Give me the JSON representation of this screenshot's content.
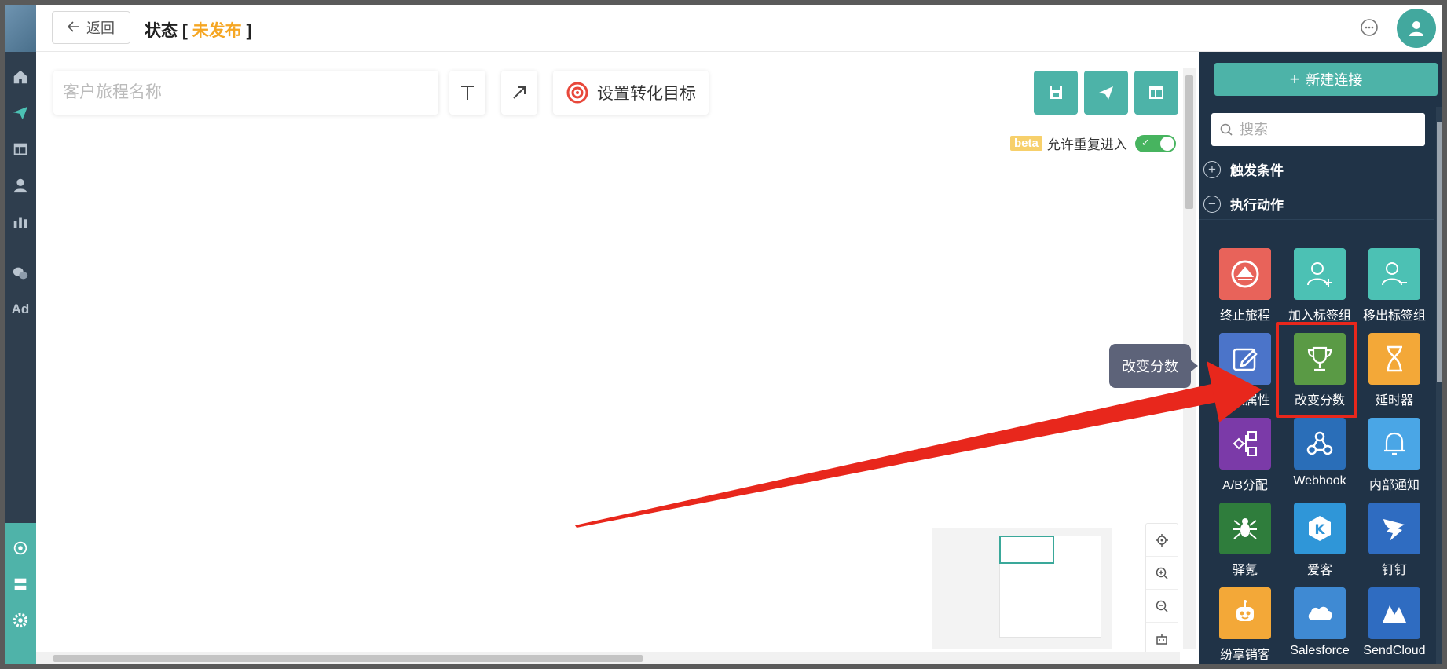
{
  "header": {
    "back_label": "返回",
    "status_label": "状态",
    "status_open": "[",
    "status_value": "未发布",
    "status_close": "]"
  },
  "canvas": {
    "journey_name_placeholder": "客户旅程名称",
    "goal_label": "设置转化目标",
    "beta_badge": "beta",
    "reentry_label": "允许重复进入",
    "reentry_enabled": true
  },
  "tooltip": {
    "text": "改变分数"
  },
  "panel": {
    "new_connection_label": "新建连接",
    "search_placeholder": "搜索",
    "groups": [
      {
        "label": "触发条件",
        "expanded": false
      },
      {
        "label": "执行动作",
        "expanded": true
      }
    ],
    "actions": [
      {
        "label": "终止旅程",
        "color": "#e8635a",
        "icon": "eject-icon"
      },
      {
        "label": "加入标签组",
        "color": "#4cc1b4",
        "icon": "user-plus-icon"
      },
      {
        "label": "移出标签组",
        "color": "#4cc1b4",
        "icon": "user-minus-icon"
      },
      {
        "label": "修改属性",
        "color": "#4b74c9",
        "icon": "edit-icon"
      },
      {
        "label": "改变分数",
        "color": "#5a9a45",
        "icon": "trophy-icon"
      },
      {
        "label": "延时器",
        "color": "#f3a838",
        "icon": "hourglass-icon"
      },
      {
        "label": "A/B分配",
        "color": "#7b3aa8",
        "icon": "split-icon"
      },
      {
        "label": "Webhook",
        "color": "#2a6eb8",
        "icon": "webhook-icon"
      },
      {
        "label": "内部通知",
        "color": "#4aa6e6",
        "icon": "bell-icon"
      },
      {
        "label": "驿氪",
        "color": "#2f7d3c",
        "icon": "spider-icon"
      },
      {
        "label": "爱客",
        "color": "#2f96d8",
        "icon": "k-icon"
      },
      {
        "label": "钉钉",
        "color": "#2f6cc1",
        "icon": "dingtalk-icon"
      },
      {
        "label": "纷享销客",
        "color": "#f3a838",
        "icon": "robot-icon"
      },
      {
        "label": "Salesforce",
        "color": "#3f8ad3",
        "icon": "cloud-icon"
      },
      {
        "label": "SendCloud",
        "color": "#2f6cc1",
        "icon": "mountain-icon"
      }
    ]
  },
  "colors": {
    "accent": "#4db3a8",
    "nav_bg": "#2f3e4e",
    "panel_bg": "#203347",
    "status_unpublished": "#f5a623",
    "annotation_red": "#e8271c"
  }
}
